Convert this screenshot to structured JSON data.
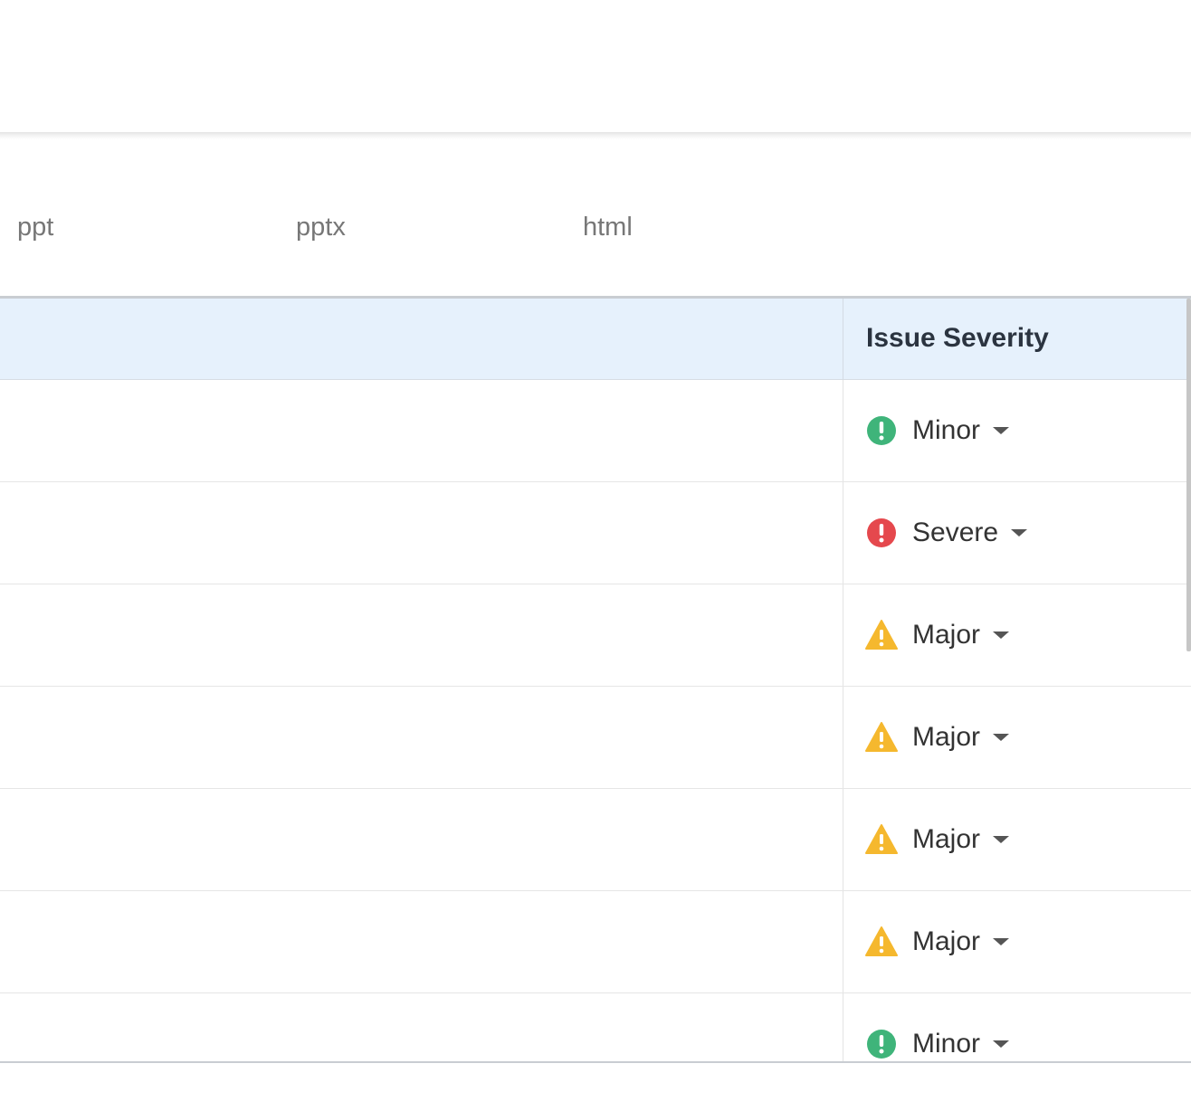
{
  "formats": [
    "ppt",
    "pptx",
    "html"
  ],
  "table": {
    "header": {
      "severity": "Issue Severity"
    },
    "rows": [
      {
        "severity": "Minor",
        "icon": "minor"
      },
      {
        "severity": "Severe",
        "icon": "severe"
      },
      {
        "severity": "Major",
        "icon": "major"
      },
      {
        "severity": "Major",
        "icon": "major"
      },
      {
        "severity": "Major",
        "icon": "major"
      },
      {
        "severity": "Major",
        "icon": "major"
      },
      {
        "severity": "Minor",
        "icon": "minor"
      }
    ]
  },
  "colors": {
    "minor": "#3fb47a",
    "severe": "#e5484d",
    "major": "#f5b82e",
    "header_bg": "#e6f1fc"
  },
  "icons": {
    "minor": "exclamation-circle-icon",
    "severe": "exclamation-circle-icon",
    "major": "warning-triangle-icon",
    "caret": "caret-down-icon"
  }
}
